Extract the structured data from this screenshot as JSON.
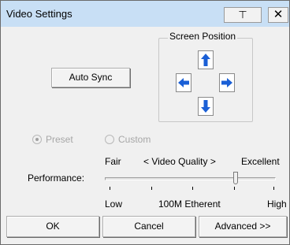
{
  "window": {
    "title": "Video Settings",
    "pin_label": "⊤",
    "close_label": "✕"
  },
  "auto_sync": {
    "label": "Auto Sync"
  },
  "screen_position": {
    "label": "Screen Position",
    "arrows": [
      "arrow-up-icon",
      "arrow-left-icon",
      "arrow-right-icon",
      "arrow-down-icon"
    ],
    "arrow_color": "#1a5fd6"
  },
  "mode": {
    "options": [
      {
        "label": "Preset",
        "selected": true,
        "enabled": false
      },
      {
        "label": "Custom",
        "selected": false,
        "enabled": false
      }
    ]
  },
  "quality": {
    "top_left": "Fair",
    "top_center": "< Video Quality >",
    "top_right": "Excellent",
    "row_label": "Performance:",
    "bottom_left": "Low",
    "bottom_center": "100M Etherent",
    "bottom_right": "High",
    "slider_value_fraction": 0.77
  },
  "buttons": {
    "ok": "OK",
    "cancel": "Cancel",
    "advanced": "Advanced >>"
  },
  "colors": {
    "titlebar": "#c8dff5",
    "dialog_bg": "#f0f0f0",
    "disabled_text": "#a7a7a7"
  }
}
